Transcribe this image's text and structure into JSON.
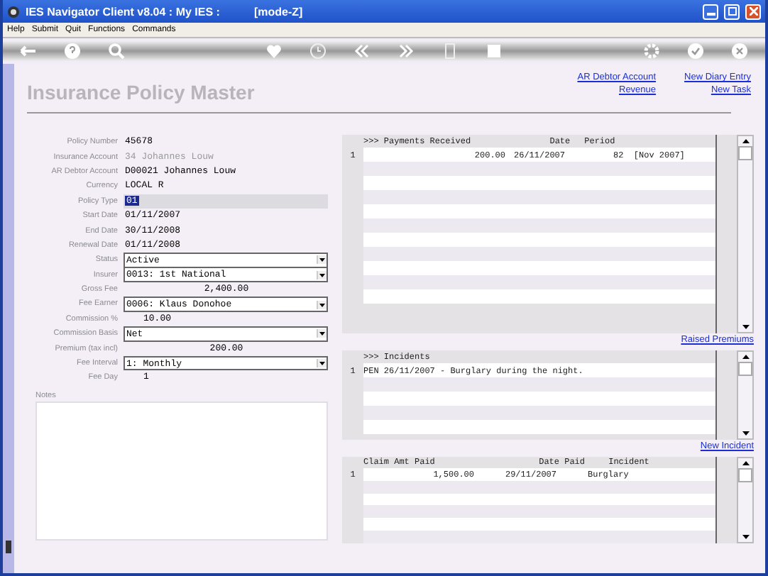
{
  "window": {
    "title": "IES Navigator Client v8.04 : My IES :",
    "mode": "[mode-Z]"
  },
  "menu": [
    "Help",
    "Submit",
    "Quit",
    "Functions",
    "Commands"
  ],
  "page_title": "Insurance Policy Master",
  "links": [
    {
      "label": "AR Debtor Account"
    },
    {
      "label": "New Diary Entry"
    },
    {
      "label": "Revenue"
    },
    {
      "label": "New Task"
    }
  ],
  "form": [
    {
      "label": "Policy Number",
      "value": "45678",
      "kind": "text",
      "disabled": false,
      "focused": false
    },
    {
      "label": "Insurance Account",
      "value": "34 Johannes Louw",
      "kind": "text",
      "disabled": true,
      "focused": false
    },
    {
      "label": "AR Debtor Account",
      "value": "D00021 Johannes Louw",
      "kind": "text",
      "disabled": false,
      "focused": false
    },
    {
      "label": "Currency",
      "value": "LOCAL R",
      "kind": "text",
      "disabled": false,
      "focused": false
    },
    {
      "label": "Policy Type",
      "value": "01",
      "kind": "text",
      "disabled": false,
      "focused": true
    },
    {
      "label": "Start Date",
      "value": "01/11/2007",
      "kind": "text",
      "disabled": false,
      "focused": false
    },
    {
      "label": "End Date",
      "value": "30/11/2008",
      "kind": "text",
      "disabled": false,
      "focused": false
    },
    {
      "label": "Renewal Date",
      "value": "01/11/2008",
      "kind": "text",
      "disabled": false,
      "focused": false
    },
    {
      "label": "Status",
      "value": "Active",
      "kind": "select",
      "disabled": false,
      "focused": false
    },
    {
      "label": "Insurer",
      "value": "0013: 1st National",
      "kind": "select",
      "disabled": false,
      "focused": false
    },
    {
      "label": "Gross Fee",
      "value": "2,400.00",
      "kind": "amount",
      "disabled": false,
      "focused": false
    },
    {
      "label": "Fee Earner",
      "value": "0006: Klaus Donohoe",
      "kind": "select",
      "disabled": false,
      "focused": false
    },
    {
      "label": "Commission %",
      "value": "10.00",
      "kind": "short",
      "disabled": false,
      "focused": false
    },
    {
      "label": "Commission Basis",
      "value": "Net",
      "kind": "select",
      "disabled": false,
      "focused": false
    },
    {
      "label": "Premium (tax incl)",
      "value": "200.00",
      "kind": "amount",
      "disabled": false,
      "focused": false
    },
    {
      "label": "Fee Interval",
      "value": "1: Monthly",
      "kind": "select",
      "disabled": false,
      "focused": false
    },
    {
      "label": "Fee Day",
      "value": "1",
      "kind": "short",
      "disabled": false,
      "focused": false
    }
  ],
  "notes_label": "Notes",
  "grids": [
    {
      "kind": "payments",
      "columns": [
        ">>> Payments Received",
        "Date",
        "Period"
      ],
      "rows": [
        {
          "number": "1",
          "cells": [
            "200.00",
            "26/11/2007",
            "82  [Nov 2007]"
          ]
        }
      ],
      "link": "Raised Premiums"
    },
    {
      "kind": "incidents",
      "columns": [
        ">>> Incidents"
      ],
      "rows": [
        {
          "number": "1",
          "cells": [
            "PEN 26/11/2007 - Burglary during the night."
          ]
        }
      ],
      "link": "New Incident"
    },
    {
      "kind": "claims",
      "columns": [
        "Claim Amt Paid",
        "Date Paid",
        "Incident"
      ],
      "rows": [
        {
          "number": "1",
          "cells": [
            "1,500.00",
            "29/11/2007",
            "Burglary"
          ]
        }
      ]
    }
  ]
}
